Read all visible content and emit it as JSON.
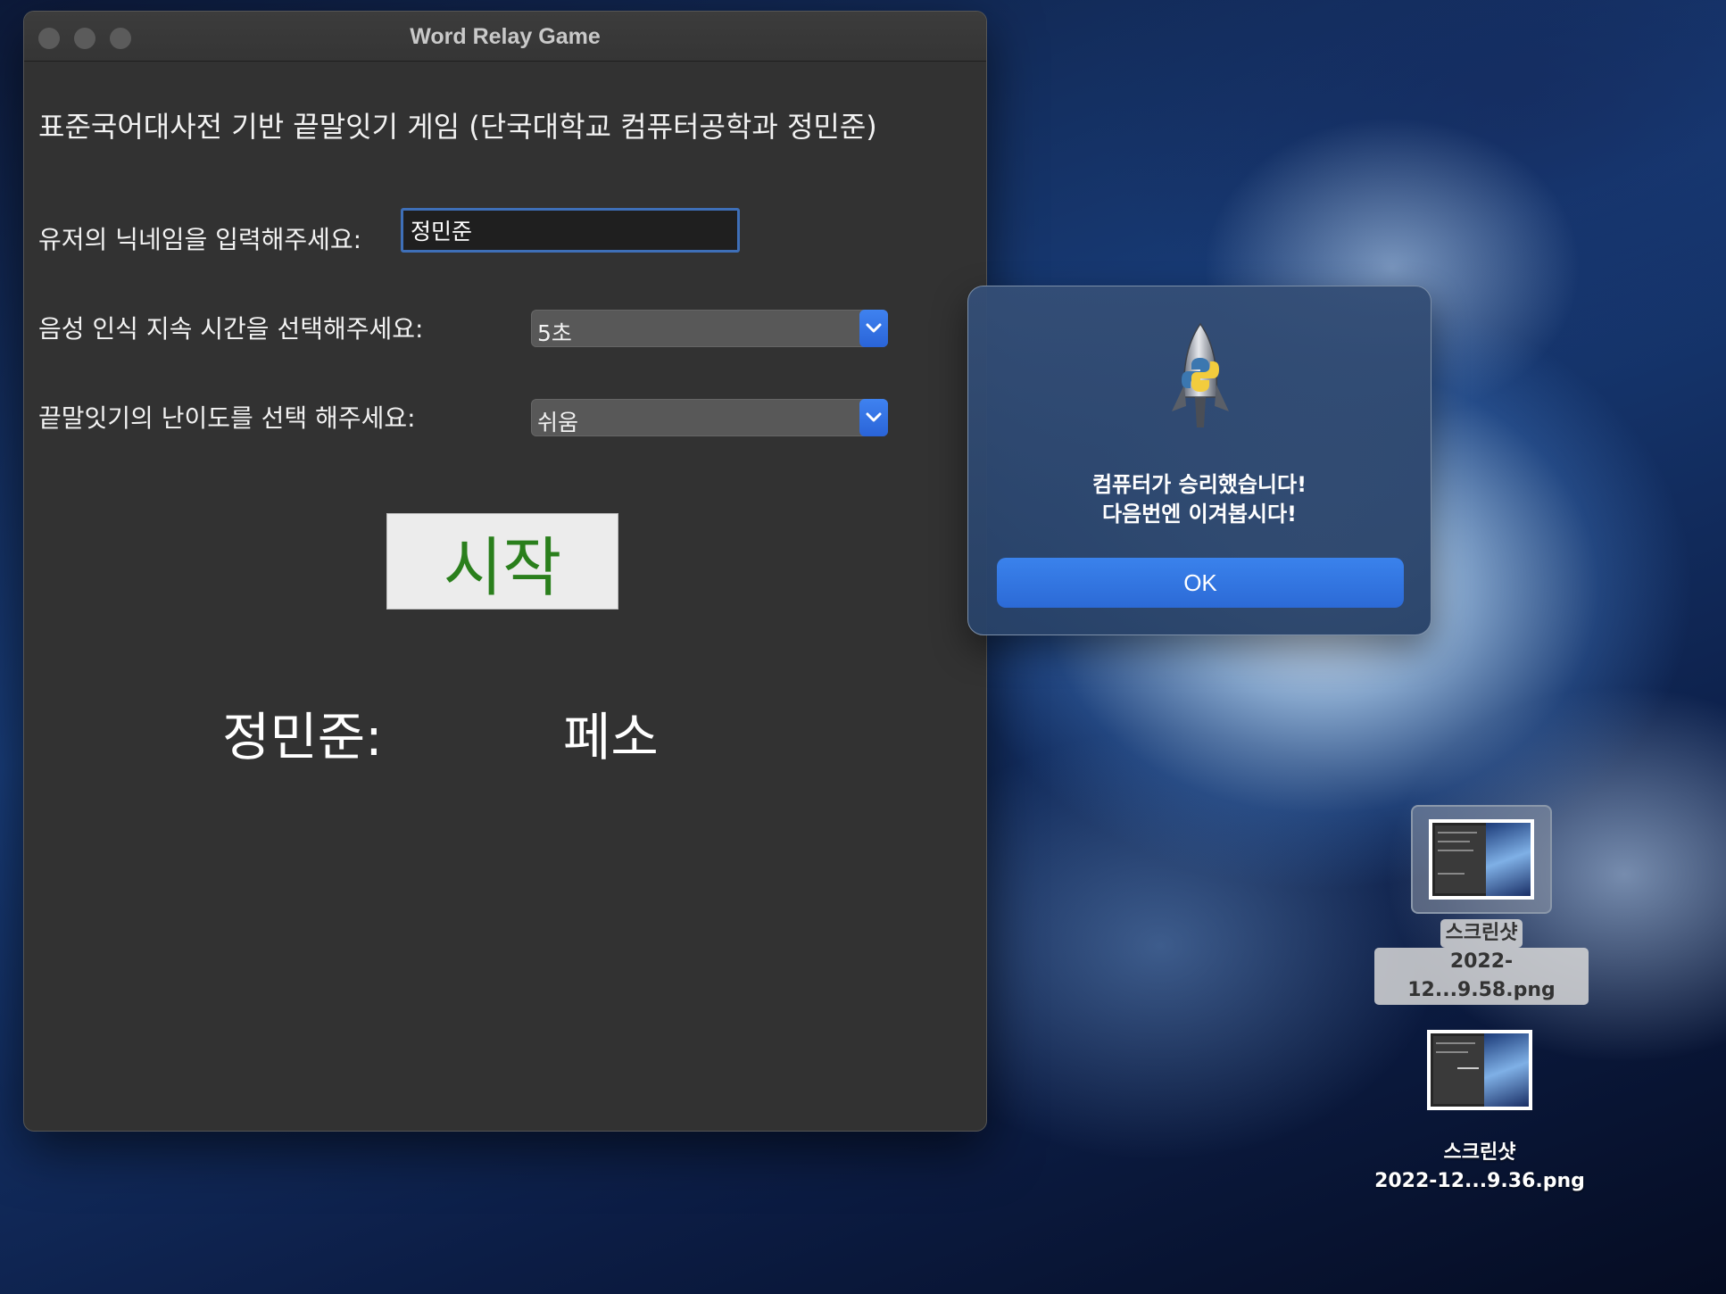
{
  "window": {
    "title": "Word Relay Game"
  },
  "main": {
    "heading": "표준국어대사전 기반 끝말잇기 게임 (단국대학교 컴퓨터공학과 정민준)",
    "nickname": {
      "label": "유저의 닉네임을 입력해주세요:",
      "value": "정민준"
    },
    "duration": {
      "label": "음성 인식 지속 시간을 선택해주세요:",
      "selected": "5초"
    },
    "difficulty": {
      "label": "끝말잇기의 난이도를 선택 해주세요:",
      "selected": "쉬움"
    },
    "start_label": "시작",
    "player_label": "정민준:",
    "current_word": "페소"
  },
  "alert": {
    "line1": "컴퓨터가 승리했습니다!",
    "line2": "다음번엔 이겨봅시다!",
    "ok_label": "OK",
    "icon": "python-rocket-icon"
  },
  "desktop": {
    "files": [
      {
        "name_line1": "스크린샷",
        "name_line2": "2022-12...9.58.png",
        "selected": true
      },
      {
        "name_line1": "스크린샷",
        "name_line2": "2022-12...9.36.png",
        "selected": false
      }
    ]
  },
  "colors": {
    "accent": "#2c6ad6",
    "start_text": "#2a7f1c",
    "window_bg": "#323232"
  }
}
